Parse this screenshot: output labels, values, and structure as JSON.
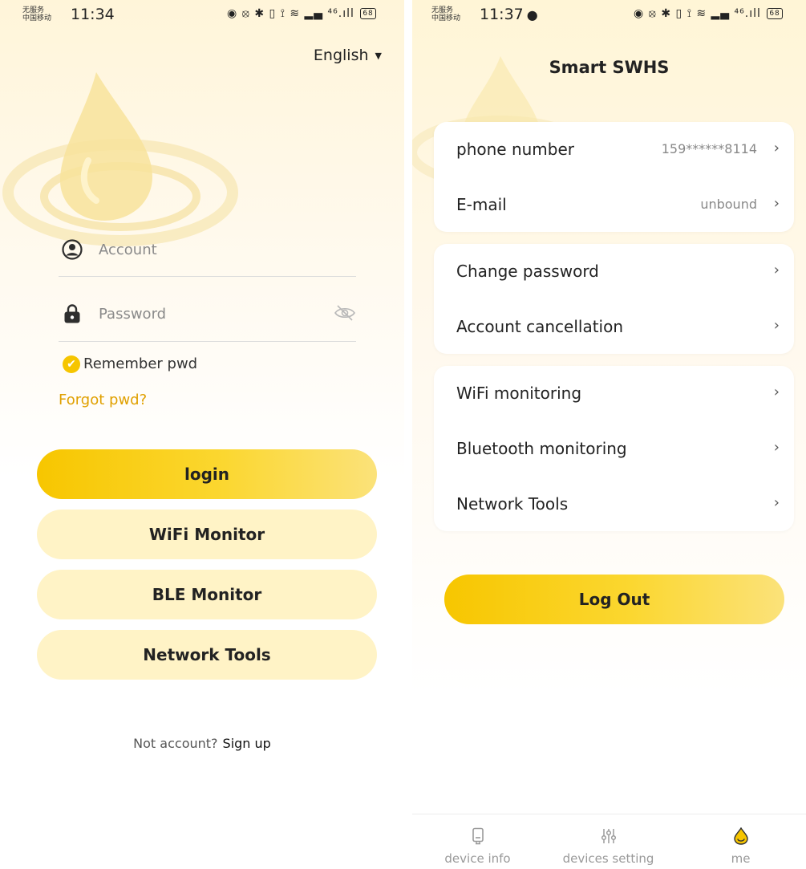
{
  "colors": {
    "accent": "#f6c500",
    "link": "#e0a000",
    "secondary_button": "#fff3c6",
    "background_top": "#fff5d9"
  },
  "login_screen": {
    "status": {
      "carrier_line1": "无服务",
      "carrier_line2": "中国移动",
      "time": "11:34",
      "icons": "◉ ⦻ ✱ ▯ ⟟ ≋ ▂▄ ⁴⁶.ıll",
      "battery": "68"
    },
    "language": "English",
    "account_placeholder": "Account",
    "password_placeholder": "Password",
    "remember_label": "Remember pwd",
    "remember_checked": true,
    "forgot_label": "Forgot pwd?",
    "buttons": {
      "login": "login",
      "wifi_monitor": "WiFi Monitor",
      "ble_monitor": "BLE Monitor",
      "network_tools": "Network Tools"
    },
    "signup_prompt": "Not account?",
    "signup_link": "Sign up"
  },
  "me_screen": {
    "status": {
      "carrier_line1": "无服务",
      "carrier_line2": "中国移动",
      "time": "11:37",
      "icons": "◉ ⦻ ✱ ▯ ⟟ ≋ ▂▄ ⁴⁶.ıll",
      "battery": "68"
    },
    "title": "Smart SWHS",
    "account_card": {
      "phone_label": "phone number",
      "phone_value": "159******8114",
      "email_label": "E-mail",
      "email_value": "unbound"
    },
    "security_card": {
      "change_password": "Change password",
      "account_cancellation": "Account cancellation"
    },
    "tools_card": {
      "wifi_monitoring": "WiFi monitoring",
      "bluetooth_monitoring": "Bluetooth monitoring",
      "network_tools": "Network Tools"
    },
    "logout_label": "Log Out",
    "nav": {
      "device_info": "device info",
      "devices_setting": "devices setting",
      "me": "me",
      "active": "me"
    }
  }
}
